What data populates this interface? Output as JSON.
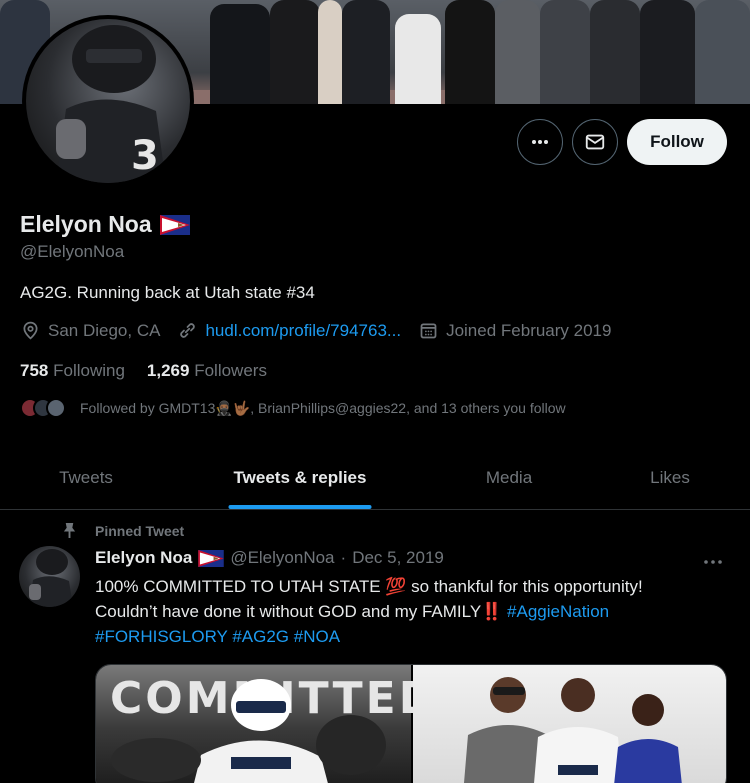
{
  "profile": {
    "name": "Elelyon Noa",
    "handle": "@ElelyonNoa",
    "bio": "AG2G. Running back at Utah state #34",
    "location": "San Diego, CA",
    "website": "hudl.com/profile/794763...",
    "joined": "Joined February 2019",
    "following_count": "758",
    "following_label": "Following",
    "followers_count": "1,269",
    "followers_label": "Followers",
    "followed_by": "Followed by GMDT13🥷🏾🤟🏾, BrianPhillips@aggies22, and 13 others you follow"
  },
  "actions": {
    "follow_label": "Follow",
    "more_icon": "more-icon",
    "message_icon": "envelope-icon"
  },
  "tabs": [
    {
      "label": "Tweets"
    },
    {
      "label": "Tweets & replies"
    },
    {
      "label": "Media"
    },
    {
      "label": "Likes"
    }
  ],
  "tweet": {
    "pinned_label": "Pinned Tweet",
    "author_name": "Elelyon Noa",
    "author_handle": "@ElelyonNoa",
    "separator": "·",
    "date": "Dec 5, 2019",
    "line1": "100% COMMITTED TO UTAH STATE 💯 so thankful for this opportunity!",
    "line2_text": "Couldn’t have done it without GOD and my FAMILY‼️ ",
    "hashtag1": "#AggieNation",
    "hashtag2": "#FORHISGLORY",
    "hashtag3": "#AG2G",
    "hashtag4": "#NOA",
    "media_overlay": "COMMITTED"
  },
  "colors": {
    "accent": "#1d9bf0",
    "background": "#000000",
    "text": "#e7e9ea",
    "secondary": "#71767b"
  }
}
